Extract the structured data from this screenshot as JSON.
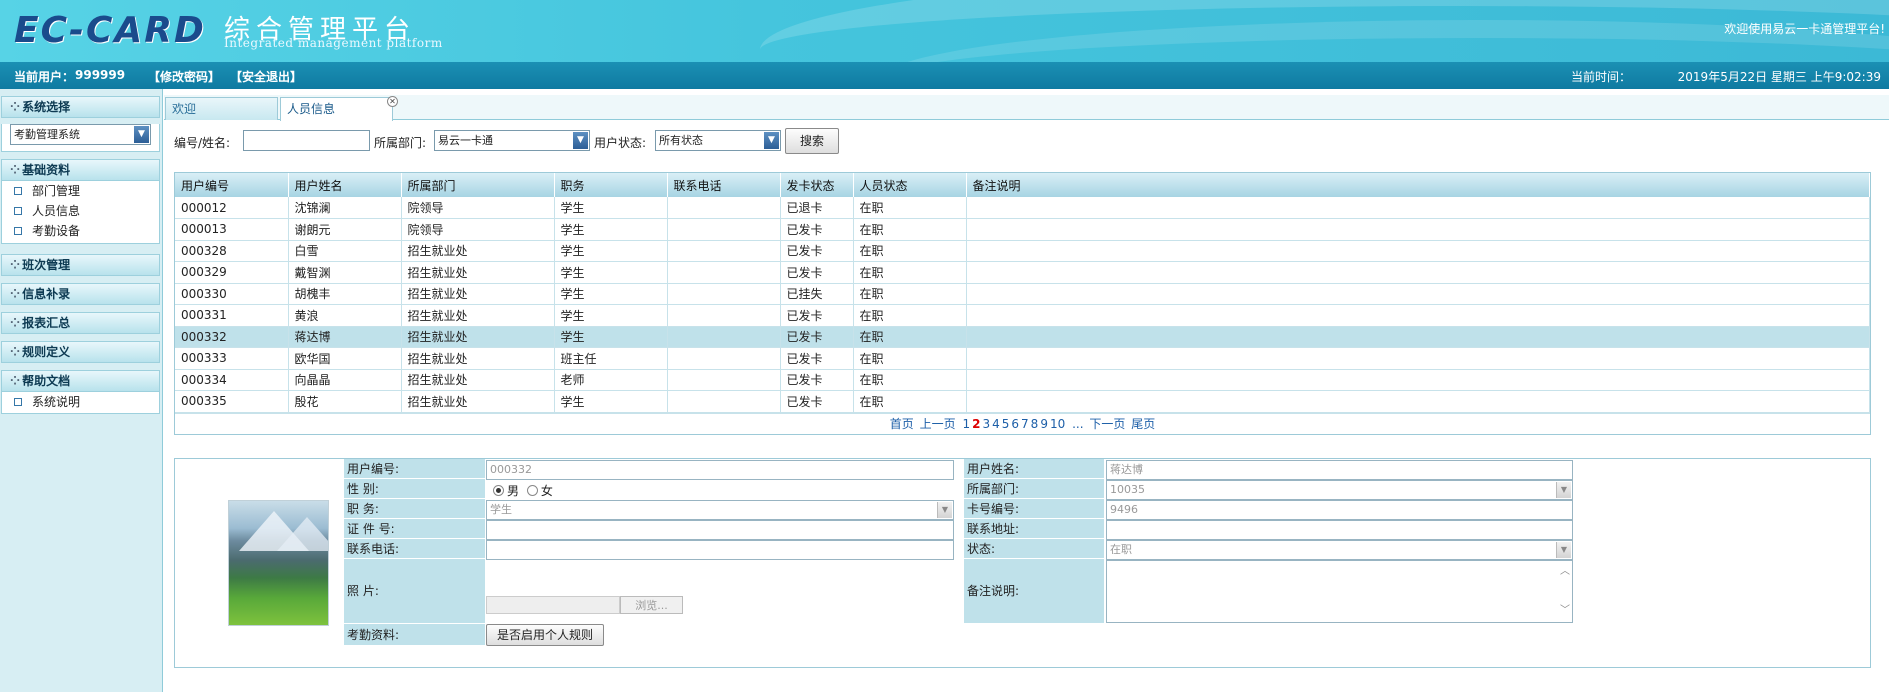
{
  "header": {
    "logo_text": "EC-CARD",
    "title_cn": "综合管理平台",
    "title_en": "Integrated management platform",
    "welcome": "欢迎使用易云一卡通管理平台!"
  },
  "subbar": {
    "current_user_label": "当前用户：",
    "current_user": "999999",
    "change_password": "【修改密码】",
    "logout": "【安全退出】",
    "time_label": "当前时间：",
    "time_value": "2019年5月22日 星期三 上午9:02:39"
  },
  "sidebar": {
    "system_select_title": "系统选择",
    "system_select_value": "考勤管理系统",
    "sections": [
      {
        "title": "基础资料",
        "items": [
          "部门管理",
          "人员信息",
          "考勤设备"
        ]
      },
      {
        "title": "班次管理",
        "items": []
      },
      {
        "title": "信息补录",
        "items": []
      },
      {
        "title": "报表汇总",
        "items": []
      },
      {
        "title": "规则定义",
        "items": []
      },
      {
        "title": "帮助文档",
        "items": [
          "系统说明"
        ]
      }
    ]
  },
  "tabs": [
    {
      "label": "欢迎"
    },
    {
      "label": "人员信息"
    }
  ],
  "search": {
    "id_name_label": "编号/姓名:",
    "id_name_value": "",
    "dept_label": "所属部门:",
    "dept_value": "易云一卡通",
    "status_label": "用户状态:",
    "status_value": "所有状态",
    "search_button": "搜索"
  },
  "table": {
    "headers": [
      "用户编号",
      "用户姓名",
      "所属部门",
      "职务",
      "联系电话",
      "发卡状态",
      "人员状态",
      "备注说明"
    ],
    "rows": [
      [
        "000012",
        "沈锦澜",
        "院领导",
        "学生",
        "",
        "已退卡",
        "在职",
        ""
      ],
      [
        "000013",
        "谢朗元",
        "院领导",
        "学生",
        "",
        "已发卡",
        "在职",
        ""
      ],
      [
        "000328",
        "白雪",
        "招生就业处",
        "学生",
        "",
        "已发卡",
        "在职",
        ""
      ],
      [
        "000329",
        "戴智渊",
        "招生就业处",
        "学生",
        "",
        "已发卡",
        "在职",
        ""
      ],
      [
        "000330",
        "胡槐丰",
        "招生就业处",
        "学生",
        "",
        "已挂失",
        "在职",
        ""
      ],
      [
        "000331",
        "黄浪",
        "招生就业处",
        "学生",
        "",
        "已发卡",
        "在职",
        ""
      ],
      [
        "000332",
        "蒋达博",
        "招生就业处",
        "学生",
        "",
        "已发卡",
        "在职",
        ""
      ],
      [
        "000333",
        "欧华国",
        "招生就业处",
        "班主任",
        "",
        "已发卡",
        "在职",
        ""
      ],
      [
        "000334",
        "向晶晶",
        "招生就业处",
        "老师",
        "",
        "已发卡",
        "在职",
        ""
      ],
      [
        "000335",
        "殷花",
        "招生就业处",
        "学生",
        "",
        "已发卡",
        "在职",
        ""
      ]
    ],
    "selected_row": 6
  },
  "pager": {
    "first": "首页",
    "prev": "上一页",
    "pages": [
      "1",
      "2",
      "3",
      "4",
      "5",
      "6",
      "7",
      "8",
      "9",
      "10"
    ],
    "current": "2",
    "ellipsis": "...",
    "next": "下一页",
    "last": "尾页"
  },
  "detail": {
    "user_id_label": "用户编号:",
    "user_id": "000332",
    "user_name_label": "用户姓名:",
    "user_name": "蒋达博",
    "gender_label": "性  别:",
    "gender_male": "男",
    "gender_female": "女",
    "dept_label": "所属部门:",
    "dept": "10035",
    "duty_label": "职  务:",
    "duty": "学生",
    "card_no_label": "卡号编号:",
    "card_no": "9496",
    "id_no_label": "证 件 号:",
    "id_no": "",
    "address_label": "联系地址:",
    "address": "",
    "phone_label": "联系电话:",
    "phone": "",
    "status_label": "状态:",
    "status": "在职",
    "photo_label": "照  片:",
    "browse_button": "浏览...",
    "remark_label": "备注说明:",
    "remark": "",
    "attendance_label": "考勤资料:",
    "personal_rule_button": "是否启用个人规则"
  }
}
